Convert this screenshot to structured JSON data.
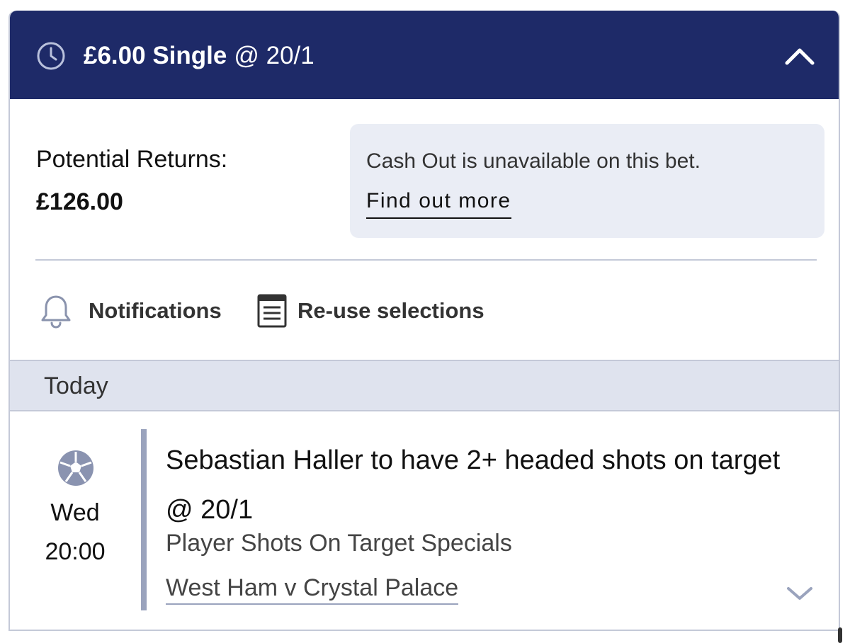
{
  "header": {
    "stake": "£6.00",
    "bet_type": "Single",
    "odds": "@ 20/1",
    "clock_icon": "clock-icon",
    "collapse_icon": "chevron-up-icon",
    "background_color": "#1e2a68"
  },
  "returns": {
    "label": "Potential Returns:",
    "value": "£126.00"
  },
  "cashout": {
    "message": "Cash Out is unavailable on this bet.",
    "link_label": "Find out more"
  },
  "actions": {
    "notifications": {
      "label": "Notifications",
      "icon": "bell-icon"
    },
    "reuse": {
      "label": "Re-use selections",
      "icon": "document-list-icon"
    }
  },
  "section": {
    "label": "Today"
  },
  "event": {
    "sport_icon": "football-icon",
    "day": "Wed",
    "time": "20:00",
    "selection": "Sebastian Haller to have 2+ headed shots on target @ 20/1",
    "market": "Player Shots On Target Specials",
    "match": "West Ham v Crystal Palace",
    "expand_icon": "chevron-down-icon"
  }
}
